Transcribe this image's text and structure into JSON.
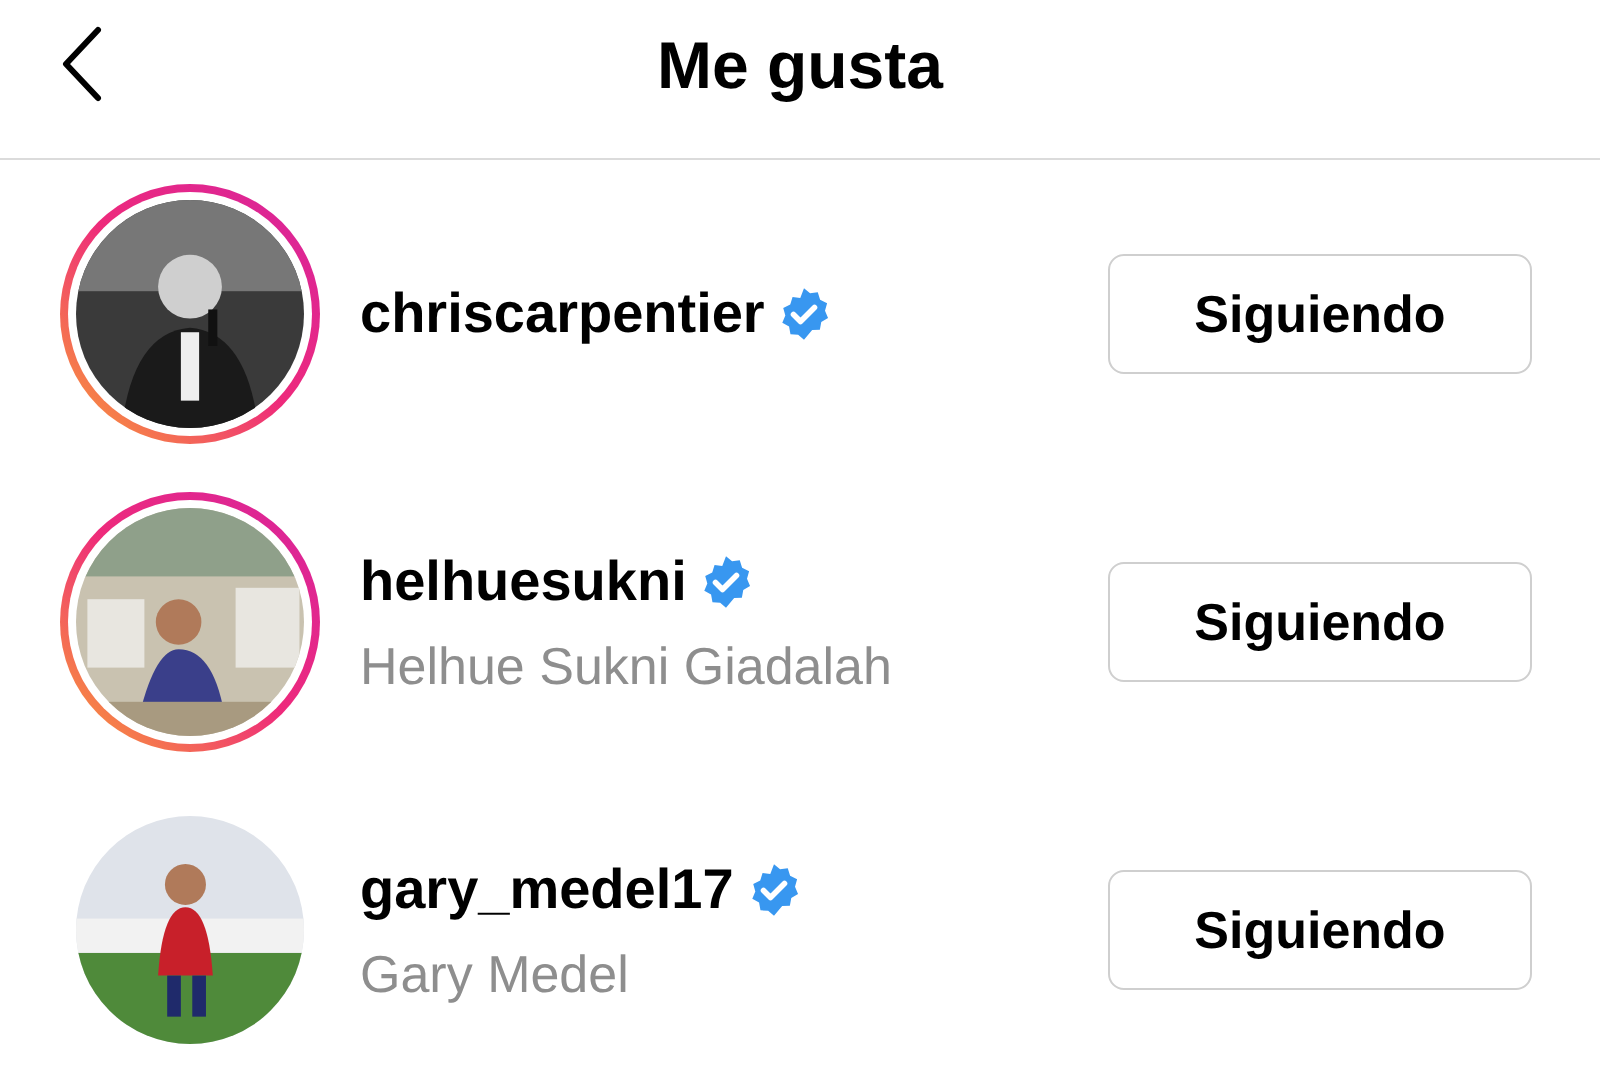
{
  "header": {
    "title": "Me gusta"
  },
  "users": [
    {
      "username": "chriscarpentier",
      "verified": true,
      "story": true,
      "button": "Siguiendo"
    },
    {
      "username": "helhuesukni",
      "name": "Helhue Sukni Giadalah",
      "verified": true,
      "story": true,
      "button": "Siguiendo"
    },
    {
      "username": "gary_medel17",
      "name": "Gary Medel",
      "verified": true,
      "story": false,
      "button": "Siguiendo"
    }
  ]
}
